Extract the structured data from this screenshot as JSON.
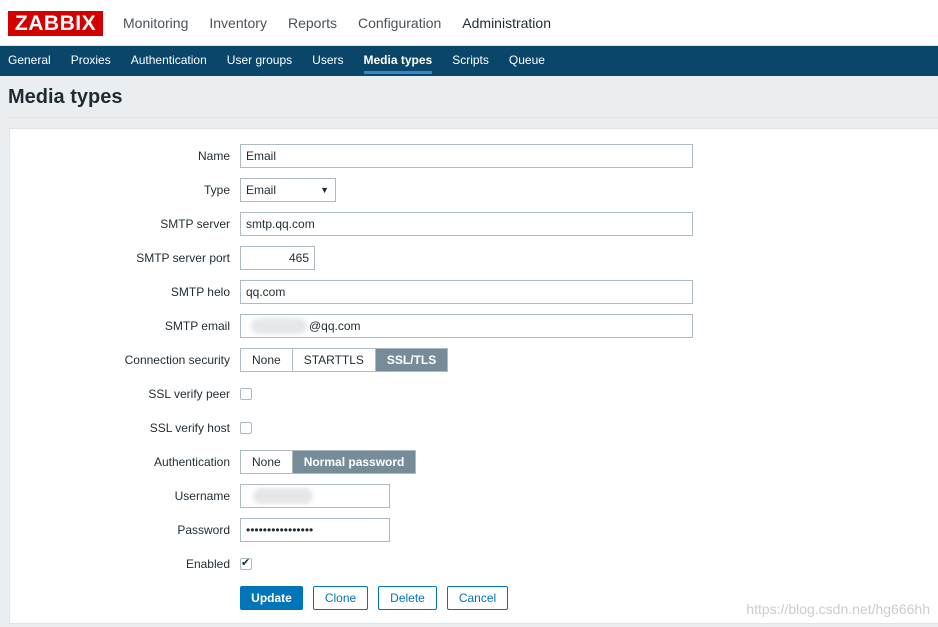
{
  "app": {
    "logo": "ZABBIX"
  },
  "main_nav": [
    {
      "label": "Monitoring"
    },
    {
      "label": "Inventory"
    },
    {
      "label": "Reports"
    },
    {
      "label": "Configuration"
    },
    {
      "label": "Administration",
      "active": true
    }
  ],
  "sub_nav": [
    {
      "label": "General"
    },
    {
      "label": "Proxies"
    },
    {
      "label": "Authentication"
    },
    {
      "label": "User groups"
    },
    {
      "label": "Users"
    },
    {
      "label": "Media types",
      "active": true
    },
    {
      "label": "Scripts"
    },
    {
      "label": "Queue"
    }
  ],
  "page": {
    "title": "Media types"
  },
  "form": {
    "name": {
      "label": "Name",
      "value": "Email"
    },
    "type": {
      "label": "Type",
      "value": "Email"
    },
    "smtp_server": {
      "label": "SMTP server",
      "value": "smtp.qq.com"
    },
    "smtp_port": {
      "label": "SMTP server port",
      "value": "465"
    },
    "smtp_helo": {
      "label": "SMTP helo",
      "value": "qq.com"
    },
    "smtp_email": {
      "label": "SMTP email",
      "value": "@qq.com"
    },
    "connection_security": {
      "label": "Connection security",
      "options": [
        "None",
        "STARTTLS",
        "SSL/TLS"
      ],
      "selected": "SSL/TLS"
    },
    "ssl_verify_peer": {
      "label": "SSL verify peer",
      "checked": false
    },
    "ssl_verify_host": {
      "label": "SSL verify host",
      "checked": false
    },
    "authentication": {
      "label": "Authentication",
      "options": [
        "None",
        "Normal password"
      ],
      "selected": "Normal password"
    },
    "username": {
      "label": "Username",
      "value": ""
    },
    "password": {
      "label": "Password",
      "value": "••••••••••••••••"
    },
    "enabled": {
      "label": "Enabled",
      "checked": true
    }
  },
  "buttons": {
    "update": "Update",
    "clone": "Clone",
    "delete": "Delete",
    "cancel": "Cancel"
  },
  "watermark": "https://blog.csdn.net/hg666hh",
  "colors": {
    "logo_red": "#d40000",
    "subnav_blue": "#0a466a",
    "primary_blue": "#0275b8",
    "selected_gray": "#768d99"
  }
}
